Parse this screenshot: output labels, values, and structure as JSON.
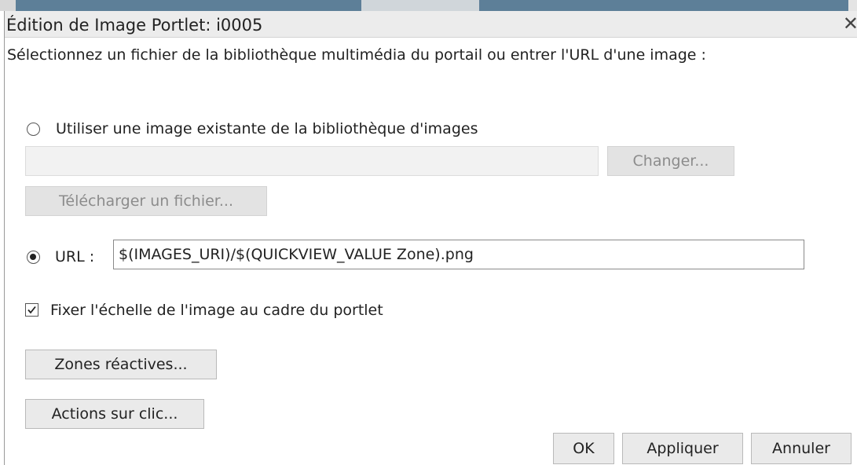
{
  "dialog": {
    "title": "Édition de Image Portlet: i0005",
    "close_glyph": "✕",
    "instruction": "Sélectionnez un fichier de la bibliothèque multimédia du portail ou entrer l'URL d'une image :"
  },
  "library_option": {
    "label": "Utiliser une image existante de la bibliothèque d'images",
    "selected": false,
    "path_value": "",
    "change_button": "Changer...",
    "upload_button": "Télécharger un fichier..."
  },
  "url_option": {
    "label": "URL :",
    "selected": true,
    "value": "$(IMAGES_URI)/$(QUICKVIEW_VALUE Zone).png"
  },
  "scale_checkbox": {
    "label": "Fixer l'échelle de l'image au cadre du portlet",
    "checked": true
  },
  "buttons": {
    "hotspots": "Zones réactives...",
    "click_actions": "Actions sur clic...",
    "ok": "OK",
    "apply": "Appliquer",
    "cancel": "Annuler"
  },
  "icons": {
    "close": "close-icon",
    "radio_unselected": "radio-unselected-icon",
    "radio_selected": "radio-selected-icon",
    "checkbox_checked": "checkbox-checked-icon"
  },
  "colors": {
    "titlebar_bg": "#ececec",
    "disabled_text": "#8c8c8c",
    "button_bg": "#eaeaea"
  }
}
